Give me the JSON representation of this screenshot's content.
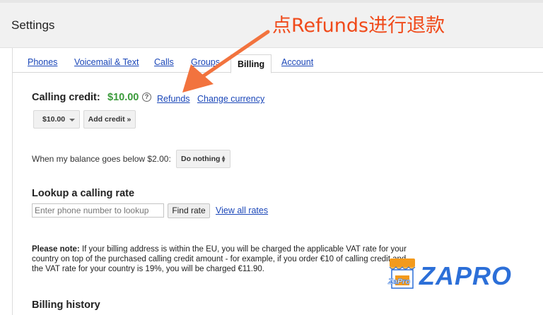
{
  "header": {
    "title": "Settings"
  },
  "annotation": {
    "text": "点Refunds进行退款",
    "color": "#f04a1a"
  },
  "tabs": [
    {
      "label": "Phones",
      "active": false
    },
    {
      "label": "Voicemail & Text",
      "active": false
    },
    {
      "label": "Calls",
      "active": false
    },
    {
      "label": "Groups",
      "active": false
    },
    {
      "label": "Billing",
      "active": true
    },
    {
      "label": "Account",
      "active": false
    }
  ],
  "billing": {
    "credit_label": "Calling credit:",
    "credit_value": "$10.00",
    "help_icon": "help-circle-icon",
    "refunds_link": "Refunds",
    "change_currency_link": "Change currency",
    "amount_select": "$10.00",
    "add_credit_button": "Add credit »",
    "balance_text": "When my balance goes below $2.00:",
    "balance_action": "Do nothing"
  },
  "lookup": {
    "title": "Lookup a calling rate",
    "placeholder": "Enter phone number to lookup",
    "find_button": "Find rate",
    "view_all_link": "View all rates"
  },
  "note": {
    "label": "Please note:",
    "text": "If your billing address is within the EU, you will be charged the applicable VAT rate for your country on top of the purchased calling credit amount - for example, if you order €10 of calling credit and the VAT rate for your country is 19%, you will be charged €11.90."
  },
  "billing_history": {
    "title": "Billing history"
  },
  "watermark": {
    "main": "ZAPRO",
    "sub": "ZaPro"
  },
  "colors": {
    "link": "#1a46b8",
    "credit": "#3a9a3a",
    "accent": "#f04a1a",
    "brand": "#2c6fd8"
  }
}
